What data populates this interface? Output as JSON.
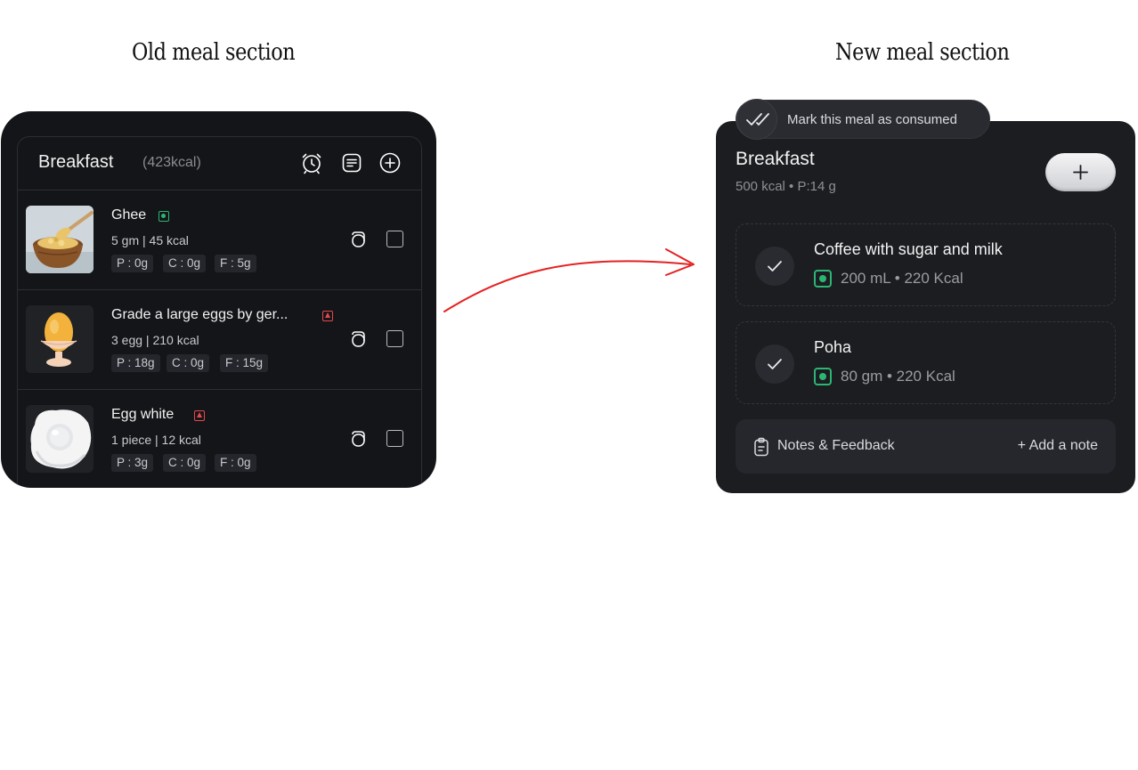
{
  "headings": {
    "old": "Old meal section",
    "new": "New meal section"
  },
  "old_section": {
    "title": "Breakfast",
    "kcal": "(423kcal)",
    "header_icons": [
      "alarm-clock-icon",
      "notes-icon",
      "add-circle-icon"
    ],
    "items": [
      {
        "name": "Ghee",
        "diet": "veg",
        "meta": "5 gm | 45 kcal",
        "macros": [
          "P : 0g",
          "C : 0g",
          "F : 5g"
        ],
        "image": "ghee-bowl-image"
      },
      {
        "name": "Grade a large eggs by ger...",
        "diet": "non-veg",
        "meta": "3 egg | 210 kcal",
        "macros": [
          "P : 18g",
          "C : 0g",
          "F : 15g"
        ],
        "image": "egg-in-cup-image"
      },
      {
        "name": "Egg white",
        "diet": "non-veg",
        "meta": "1 piece | 12 kcal",
        "macros": [
          "P : 3g",
          "C : 0g",
          "F : 0g"
        ],
        "image": "fried-egg-image"
      }
    ]
  },
  "new_section": {
    "consumed_label": "Mark this meal as consumed",
    "title": "Breakfast",
    "subtitle": "500 kcal • P:14 g",
    "items": [
      {
        "name": "Coffee with sugar and milk",
        "diet": "veg",
        "meta": "200 mL  •  220 Kcal"
      },
      {
        "name": "Poha",
        "diet": "veg",
        "meta": "80 gm  •  220 Kcal"
      }
    ],
    "notes_label": "Notes & Feedback",
    "add_note_label": "+ Add a note"
  },
  "colors": {
    "card_old": "#141518",
    "card_new": "#1c1d21",
    "veg_green": "#2bb673",
    "nonveg_red": "#e5484d",
    "arrow_red": "#e52222"
  }
}
